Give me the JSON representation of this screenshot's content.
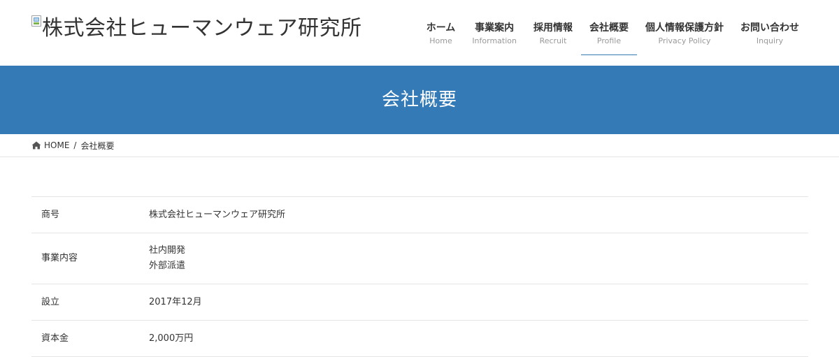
{
  "header": {
    "logo_text": "株式会社ヒューマンウェア研究所",
    "nav": [
      {
        "label": "ホーム",
        "sub": "Home"
      },
      {
        "label": "事業案内",
        "sub": "Information"
      },
      {
        "label": "採用情報",
        "sub": "Recruit"
      },
      {
        "label": "会社概要",
        "sub": "Profile",
        "active": true
      },
      {
        "label": "個人情報保護方針",
        "sub": "Privacy Policy"
      },
      {
        "label": "お問い合わせ",
        "sub": "Inquiry"
      }
    ]
  },
  "page_header": {
    "title": "会社概要",
    "background": "#337ab7"
  },
  "breadcrumb": {
    "home_label": "HOME",
    "separator": "/",
    "current": "会社概要",
    "home_icon": "home-icon"
  },
  "profile": {
    "rows": [
      {
        "label": "商号",
        "lines": [
          "株式会社ヒューマンウェア研究所"
        ]
      },
      {
        "label": "事業内容",
        "lines": [
          "社内開発",
          "外部派遣"
        ]
      },
      {
        "label": "設立",
        "lines": [
          "2017年12月"
        ]
      },
      {
        "label": "資本金",
        "lines": [
          "2,000万円"
        ]
      }
    ]
  }
}
